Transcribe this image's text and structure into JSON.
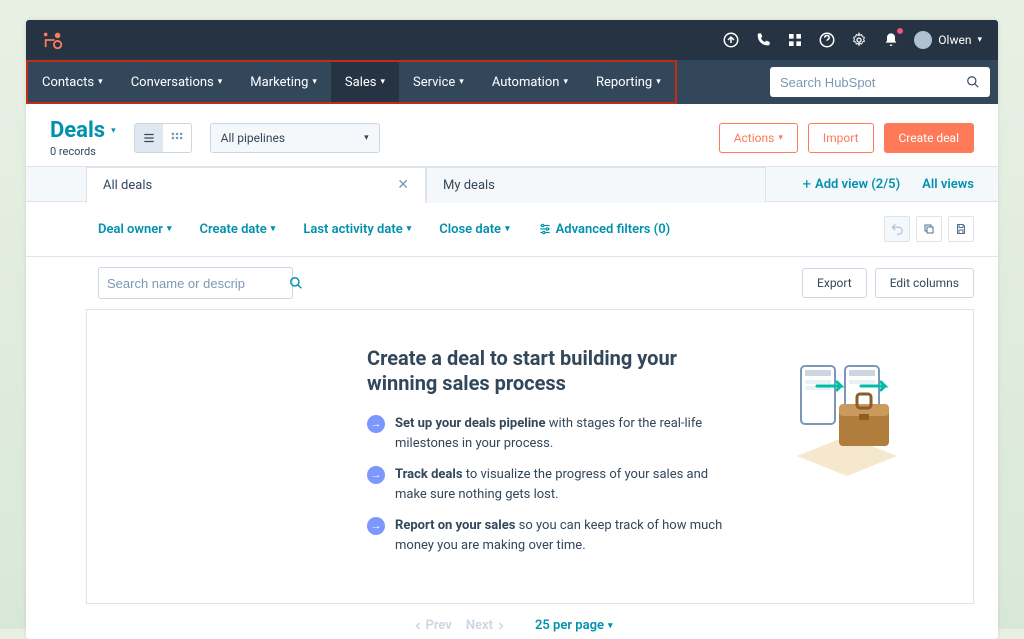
{
  "topbar": {
    "user_name": "Olwen"
  },
  "nav": {
    "items": [
      "Contacts",
      "Conversations",
      "Marketing",
      "Sales",
      "Service",
      "Automation",
      "Reporting"
    ],
    "active_index": 3
  },
  "search": {
    "placeholder": "Search HubSpot"
  },
  "page": {
    "title": "Deals",
    "records_label": "0 records"
  },
  "pipeline": {
    "label": "All pipelines"
  },
  "actions": {
    "actions_label": "Actions",
    "import_label": "Import",
    "create_label": "Create deal"
  },
  "tabs": {
    "items": [
      {
        "label": "All deals",
        "closable": true
      },
      {
        "label": "My deals",
        "closable": false
      }
    ],
    "add_view_label": "Add view (2/5)",
    "all_views_label": "All views"
  },
  "filters": {
    "items": [
      "Deal owner",
      "Create date",
      "Last activity date",
      "Close date"
    ],
    "advanced_label": "Advanced filters (0)"
  },
  "name_search": {
    "placeholder": "Search name or descrip"
  },
  "tools": {
    "export_label": "Export",
    "edit_columns_label": "Edit columns"
  },
  "empty": {
    "title": "Create a deal to start building your winning sales process",
    "bullets": [
      {
        "bold": "Set up your deals pipeline",
        "rest": " with stages for the real-life milestones in your process."
      },
      {
        "bold": "Track deals",
        "rest": " to visualize the progress of your sales and make sure nothing gets lost."
      },
      {
        "bold": "Report on your sales",
        "rest": " so you can keep track of how much money you are making over time."
      }
    ]
  },
  "pagination": {
    "prev": "Prev",
    "next": "Next",
    "per_page": "25 per page"
  }
}
